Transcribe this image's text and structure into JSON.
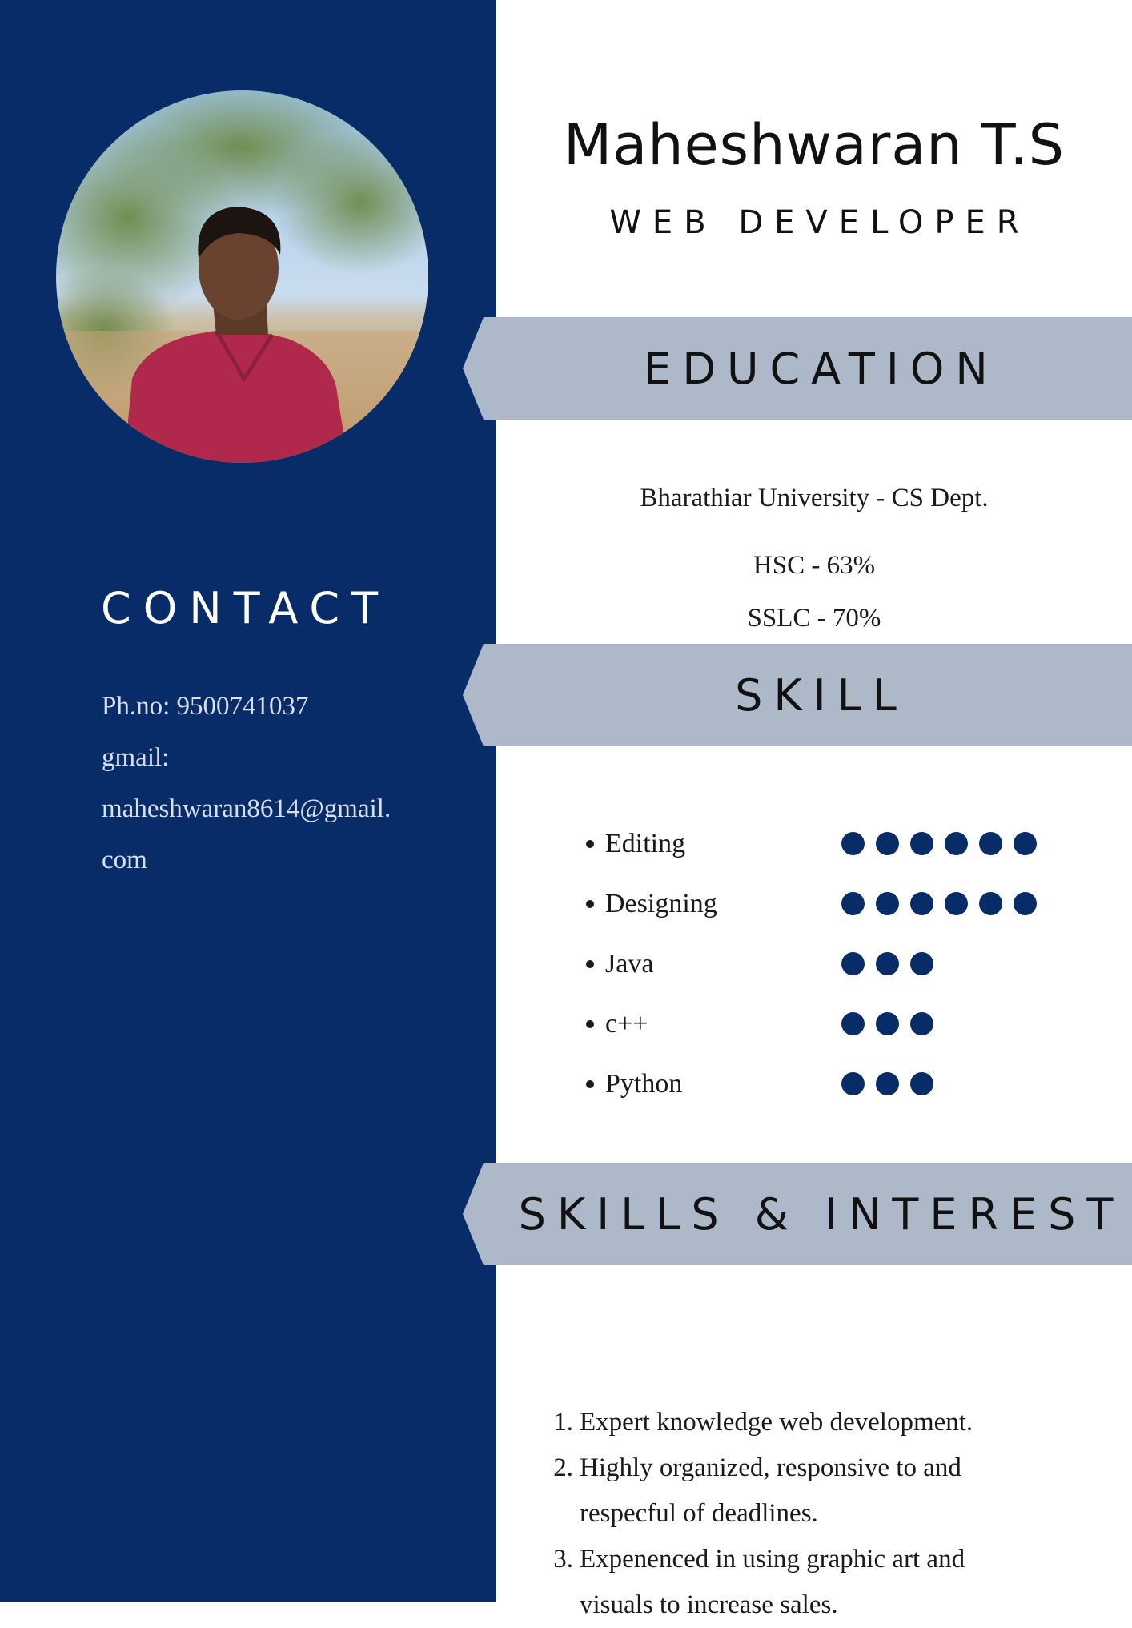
{
  "profile": {
    "name": "Maheshwaran T.S",
    "title": "WEB DEVELOPER"
  },
  "contact": {
    "heading": "CONTACT",
    "lines": [
      "Ph.no: 9500741037",
      "gmail:",
      "maheshwaran8614@gmail.",
      "com"
    ]
  },
  "education": {
    "heading": "EDUCATION",
    "items": [
      "Bharathiar University - CS Dept.",
      "HSC - 63%",
      "SSLC - 70%"
    ]
  },
  "skill": {
    "heading": "SKILL",
    "items": [
      {
        "name": "Editing",
        "level": 6
      },
      {
        "name": "Designing",
        "level": 6
      },
      {
        "name": "Java",
        "level": 3
      },
      {
        "name": "c++",
        "level": 3
      },
      {
        "name": "Python",
        "level": 3
      }
    ]
  },
  "interests": {
    "heading": "SKILLS & INTEREST",
    "items": [
      {
        "num": "1.",
        "lines": [
          "Expert knowledge web development."
        ]
      },
      {
        "num": "2.",
        "lines": [
          "Highly organized, responsive to and",
          "respecful of deadlines."
        ]
      },
      {
        "num": "3.",
        "lines": [
          "Expenenced in using graphic art and",
          "visuals to increase sales."
        ]
      }
    ]
  },
  "colors": {
    "sidebar": "#082c68",
    "banner": "#adb8c9",
    "dot": "#082c68"
  },
  "icons": {
    "photo": "profile-photo"
  }
}
